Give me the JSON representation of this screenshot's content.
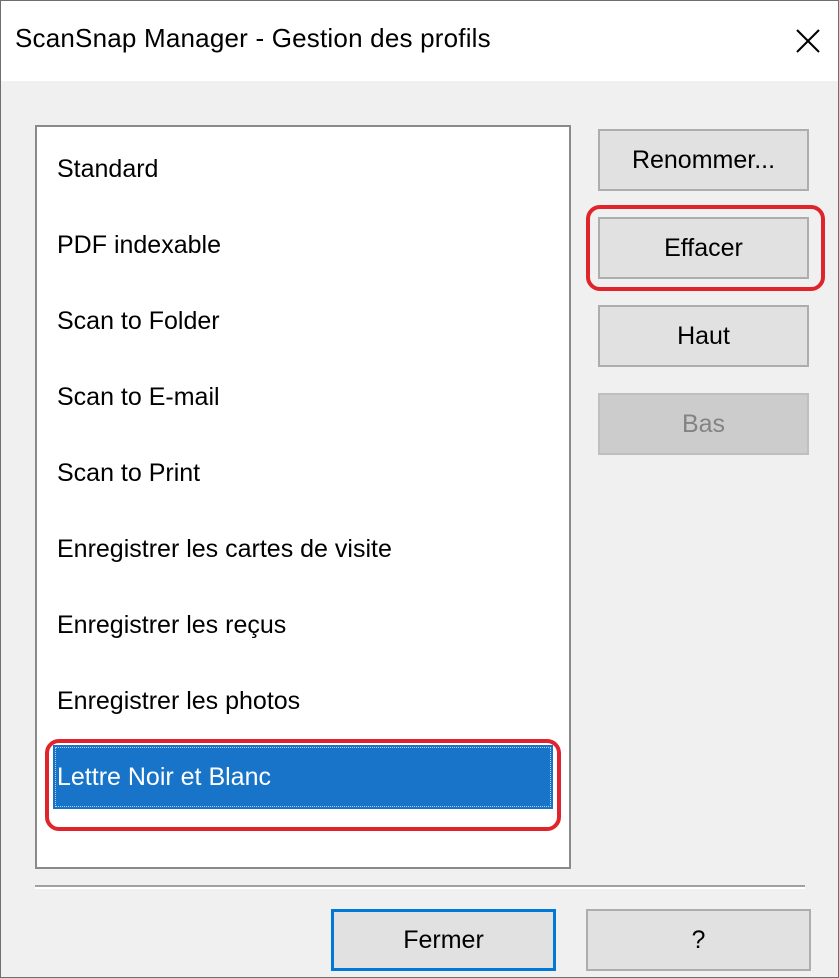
{
  "window": {
    "title": "ScanSnap Manager - Gestion des profils",
    "close_icon": "close-icon"
  },
  "profiles": {
    "items": [
      "Standard",
      "PDF indexable",
      "Scan to Folder",
      "Scan to E-mail",
      "Scan to Print",
      "Enregistrer les cartes de visite",
      "Enregistrer les reçus",
      "Enregistrer les photos",
      "Lettre Noir et Blanc"
    ],
    "selected": "Lettre Noir et Blanc"
  },
  "actions": {
    "rename_label": "Renommer...",
    "delete_label": "Effacer",
    "up_label": "Haut",
    "down_label": "Bas",
    "down_enabled": false
  },
  "footer": {
    "close_label": "Fermer",
    "help_label": "?"
  },
  "colors": {
    "selection": "#1874c9",
    "highlight": "#e0242b",
    "default_button_border": "#0078d7"
  }
}
